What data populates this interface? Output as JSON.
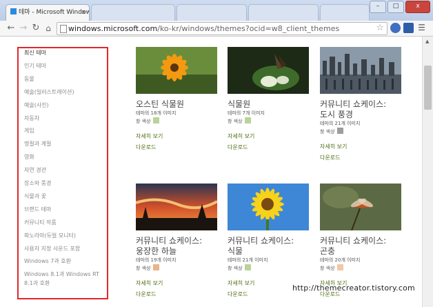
{
  "browser": {
    "active_tab_title": "테마 - Microsoft Window",
    "url_host": "windows.microsoft.com",
    "url_rest": "/ko-kr/windows/themes?ocid=w8_client_themes",
    "close_label": "x",
    "minimize_label": "–",
    "maximize_label": "□",
    "window_close_label": "x"
  },
  "sidebar": {
    "items": [
      {
        "label": "최신 테마"
      },
      {
        "label": "인기 테마"
      },
      {
        "label": "동물"
      },
      {
        "label": "예술(일러스트레이션)"
      },
      {
        "label": "예술(사진)"
      },
      {
        "label": "자동차"
      },
      {
        "label": "게임"
      },
      {
        "label": "명절과 계절"
      },
      {
        "label": "영화"
      },
      {
        "label": "자연 경관"
      },
      {
        "label": "장소와 풍경"
      },
      {
        "label": "식물과 꽃"
      },
      {
        "label": "브랜드 테마"
      },
      {
        "label": "커뮤니티 작품"
      },
      {
        "label": "파노라마(듀얼 모니터)"
      },
      {
        "label": "사용자 지정 사운드 포함"
      },
      {
        "label": "Windows 7과 호환"
      },
      {
        "label": "Windows 8.1과 Windows RT"
      },
      {
        "label": "8.1과 호환"
      }
    ]
  },
  "themes": [
    {
      "title1": "오스틴 식물원",
      "title2": "",
      "count": "테마의 18개 이미지",
      "color_label": "창 색상",
      "swatch": "#b9d39a",
      "details": "자세히 보기",
      "download": "다운로드"
    },
    {
      "title1": "식물원",
      "title2": "",
      "count": "테마의 7개 이미지",
      "color_label": "창 색상",
      "swatch": "#b9d39a",
      "details": "자세히 보기",
      "download": "다운로드"
    },
    {
      "title1": "커뮤니티 쇼케이스:",
      "title2": "도시 풍경",
      "count": "테마의 21개 이미지",
      "color_label": "창 색상",
      "swatch": "#9d9d9d",
      "details": "자세히 보기",
      "download": "다운로드"
    },
    {
      "title1": "커뮤니티 쇼케이스:",
      "title2": "웅장한 하늘",
      "count": "테마의 19개 이미지",
      "color_label": "창 색상",
      "swatch": "#e9b48c",
      "details": "자세히 보기",
      "download": "다운로드"
    },
    {
      "title1": "커뮤니티 쇼케이스:",
      "title2": "식물",
      "count": "테마의 21개 이미지",
      "color_label": "창 색상",
      "swatch": "#b9d39a",
      "details": "자세히 보기",
      "download": "다운로드"
    },
    {
      "title1": "커뮤니티 쇼케이스:",
      "title2": "곤충",
      "count": "테마의 20개 이미지",
      "color_label": "창 색상",
      "swatch": "#efc8a8",
      "details": "자세히 보기",
      "download": "다운로드"
    }
  ],
  "watermark": "http://themecreator.tistory.com",
  "colors": {
    "sidebar_highlight": "#e0262b",
    "link_green": "#4f6d11"
  }
}
